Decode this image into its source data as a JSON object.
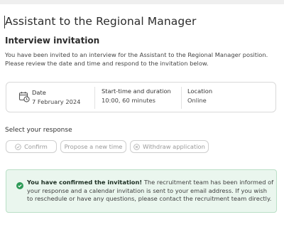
{
  "job": {
    "title": "Assistant to the Regional Manager"
  },
  "invitation": {
    "heading": "Interview invitation",
    "intro": "You have been invited to an interview for the Assistant to the Regional Manager position. Please review the date and time and respond to the invitation below."
  },
  "details": {
    "date_label": "Date",
    "date_value": "7 February 2024",
    "time_label": "Start-time and duration",
    "time_value": "10:00, 60 minutes",
    "location_label": "Location",
    "location_value": "Online"
  },
  "response": {
    "label": "Select your response",
    "confirm_label": "Confirm",
    "propose_label": "Propose a new time",
    "withdraw_label": "Withdraw application"
  },
  "alert": {
    "title": "You have confirmed the invitation!",
    "message": "The recruitment team has been informed of your response and a calendar invitation is sent to your email address. If you wish to reschedule or have any questions, please contact the recruitment team directly."
  },
  "icons": {
    "calendar": "calendar-clock-icon",
    "confirm": "check-circle-icon",
    "withdraw": "x-circle-icon",
    "alert": "check-circle-filled-icon"
  },
  "colors": {
    "success_bg": "#eaf6ee",
    "success_border": "#b9dfc6",
    "success_icon": "#2e9a57",
    "disabled_text": "#999999"
  }
}
